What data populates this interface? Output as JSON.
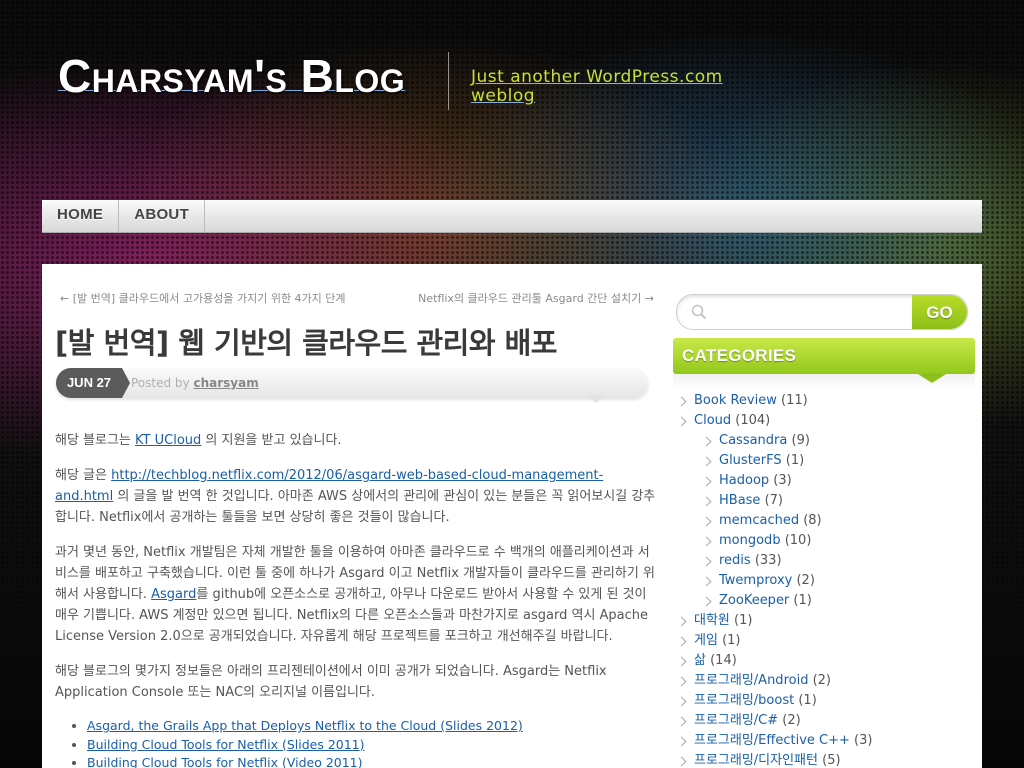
{
  "header": {
    "site_title": "Charsyam's Blog",
    "tagline": "Just another WordPress.com weblog"
  },
  "nav": {
    "items": [
      "HOME",
      "ABOUT"
    ]
  },
  "post_nav": {
    "prev": "← [발 번역] 클라우드에서 고가용성을 가지기 위한 4가지 단계",
    "next": "Netflix의 클라우드 관리툴 Asgard 간단 설치기 →"
  },
  "post": {
    "title": "[발 번역] 웹 기반의 클라우드 관리와 배포",
    "date": "JUN 27",
    "posted_by_label": "Posted by",
    "author": "charsyam",
    "p1_before": "해당 블로그는 ",
    "p1_link": "KT UCloud",
    "p1_after": " 의 지원을 받고 있습니다.",
    "p2_before": "해당 글은 ",
    "p2_link": "http://techblog.netflix.com/2012/06/asgard-web-based-cloud-management-and.html",
    "p2_after": " 의 글을 발 번역 한 것입니다. 아마존 AWS 상에서의 관리에 관심이 있는 분들은 꼭 읽어보시길 강추합니다. Netflix에서 공개하는 툴들을 보면 상당히 좋은 것들이 많습니다.",
    "p3_before": "과거 몇년 동안, Netflix 개발팀은 자체 개발한 툴을 이용하여 아마존 클라우드로 수 백개의 애플리케이션과 서비스를 배포하고 구축했습니다. 이런 툴 중에 하나가 Asgard 이고 Netflix 개발자들이 클라우드를 관리하기 위해서 사용합니다. ",
    "p3_link": "Asgard",
    "p3_after": "를 github에 오픈소스로 공개하고, 아무나 다운로드 받아서 사용할 수 있게 된 것이 매우 기쁩니다. AWS 계정만 있으면 됩니다. Netflix의 다른 오픈소스들과 마찬가지로 asgard 역시 Apache License Version 2.0으로 공개되었습니다. 자유롭게 해당 프로젝트를 포크하고 개선해주길 바랍니다.",
    "p4": "해당 블로그의 몇가지 정보들은 아래의 프리젠테이션에서 이미 공개가 되었습니다. Asgard는 Netflix Application Console 또는 NAC의 오리지널 이름입니다.",
    "links": [
      "Asgard, the Grails App that Deploys Netflix to the Cloud (Slides 2012)",
      "Building Cloud Tools for Netflix (Slides 2011)",
      "Building Cloud Tools for Netflix (Video 2011)"
    ]
  },
  "sidebar": {
    "search_placeholder": "",
    "search_button": "GO",
    "categories_title": "CATEGORIES",
    "categories": [
      {
        "name": "Book Review",
        "count": "(11)",
        "level": 0
      },
      {
        "name": "Cloud",
        "count": "(104)",
        "level": 0
      },
      {
        "name": "Cassandra",
        "count": "(9)",
        "level": 1
      },
      {
        "name": "GlusterFS",
        "count": "(1)",
        "level": 1
      },
      {
        "name": "Hadoop",
        "count": "(3)",
        "level": 1
      },
      {
        "name": "HBase",
        "count": "(7)",
        "level": 1
      },
      {
        "name": "memcached",
        "count": "(8)",
        "level": 1
      },
      {
        "name": "mongodb",
        "count": "(10)",
        "level": 1
      },
      {
        "name": "redis",
        "count": "(33)",
        "level": 1
      },
      {
        "name": "Twemproxy",
        "count": "(2)",
        "level": 1
      },
      {
        "name": "ZooKeeper",
        "count": "(1)",
        "level": 1
      },
      {
        "name": "대학원",
        "count": "(1)",
        "level": 0
      },
      {
        "name": "게임",
        "count": "(1)",
        "level": 0
      },
      {
        "name": "삶",
        "count": "(14)",
        "level": 0
      },
      {
        "name": "프로그래밍/Android",
        "count": "(2)",
        "level": 0
      },
      {
        "name": "프로그래밍/boost",
        "count": "(1)",
        "level": 0
      },
      {
        "name": "프로그래밍/C#",
        "count": "(2)",
        "level": 0
      },
      {
        "name": "프로그래밍/Effective C++",
        "count": "(3)",
        "level": 0
      },
      {
        "name": "프로그래밍/디자인패턴",
        "count": "(5)",
        "level": 0
      }
    ]
  }
}
